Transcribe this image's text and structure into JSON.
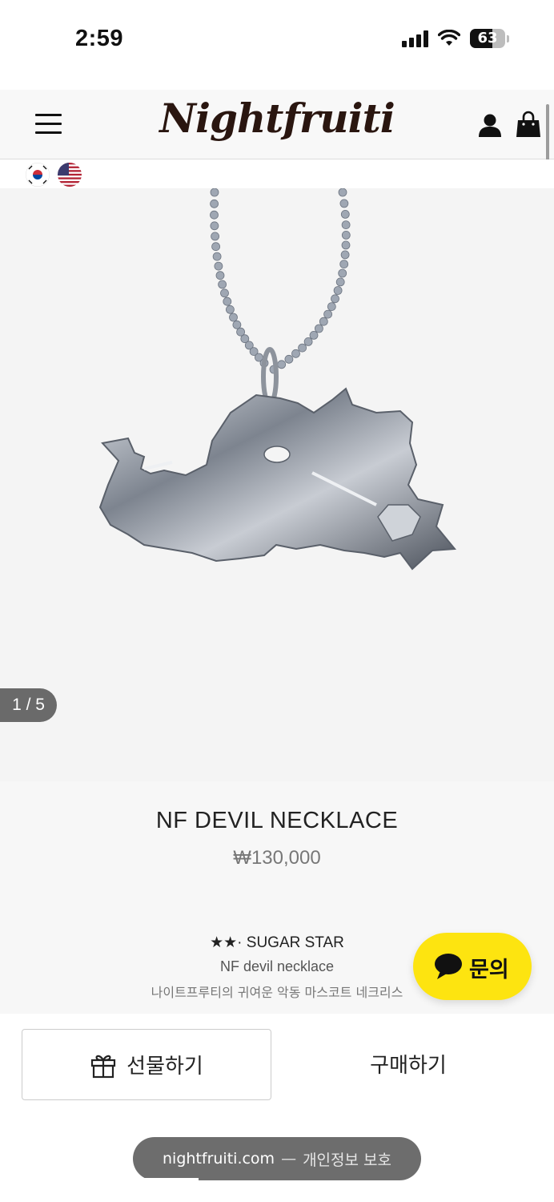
{
  "status_bar": {
    "time": "2:59",
    "battery": "63",
    "battery_level": 0.63
  },
  "header": {
    "logo": "Nightfruiti",
    "menu_icon": "hamburger-menu-icon",
    "account_icon": "user-icon",
    "cart_icon": "shopping-bag-icon"
  },
  "languages": [
    {
      "name": "korean-flag-icon"
    },
    {
      "name": "us-flag-icon"
    }
  ],
  "gallery": {
    "counter": "1 / 5",
    "current": 1,
    "total": 5
  },
  "product": {
    "name": "NF DEVIL NECKLACE",
    "price": "₩130,000"
  },
  "description": {
    "title": "★★· SUGAR STAR",
    "subtitle": "NF devil necklace",
    "korean": "나이트프루티의 귀여운 악동 마스코트 네크리스"
  },
  "inquiry": {
    "label": "문의",
    "color": "#fde410"
  },
  "actions": {
    "gift_label": "선물하기",
    "buy_label": "구매하기"
  },
  "browser": {
    "domain": "nightfruiti.com",
    "separator": "—",
    "privacy": "개인정보 보호"
  }
}
